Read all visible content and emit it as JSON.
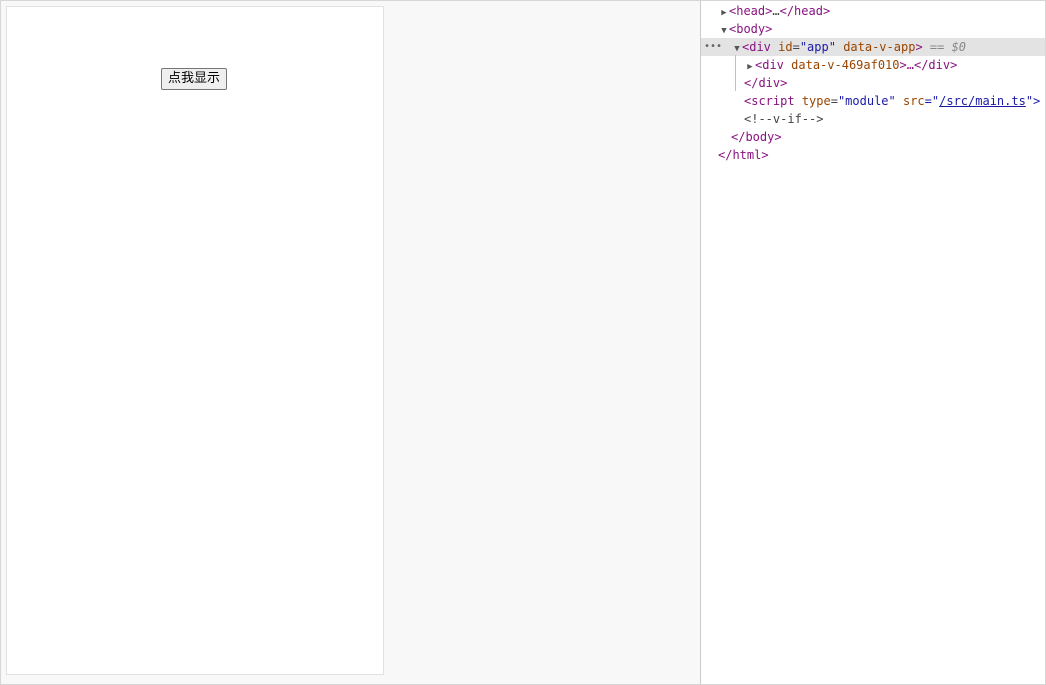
{
  "page": {
    "button_label": "点我显示"
  },
  "devtools": {
    "lines": {
      "head": {
        "open": "<head>",
        "ellipsis": "…",
        "close": "</head>"
      },
      "body_open": "<body>",
      "app_div": {
        "open_tag": "<div",
        "attr_id_name": "id",
        "attr_id_value": "\"app\"",
        "attr_flag": "data-v-app",
        "close": ">",
        "marker": "== $0"
      },
      "inner_div": {
        "open": "<div",
        "attr": "data-v-469af010",
        "rest": ">…</div>"
      },
      "div_close": "</div>",
      "script": {
        "open": "<script",
        "attr_type_name": "type",
        "attr_type_value": "\"module\"",
        "attr_src_name": "src",
        "attr_src_q1": "=\"",
        "attr_src_link": "/src/main.ts",
        "attr_src_q2": "\">"
      },
      "comment": "<!--v-if-->",
      "body_close": "</body>",
      "html_close": "</html>"
    },
    "dots": "•••"
  }
}
